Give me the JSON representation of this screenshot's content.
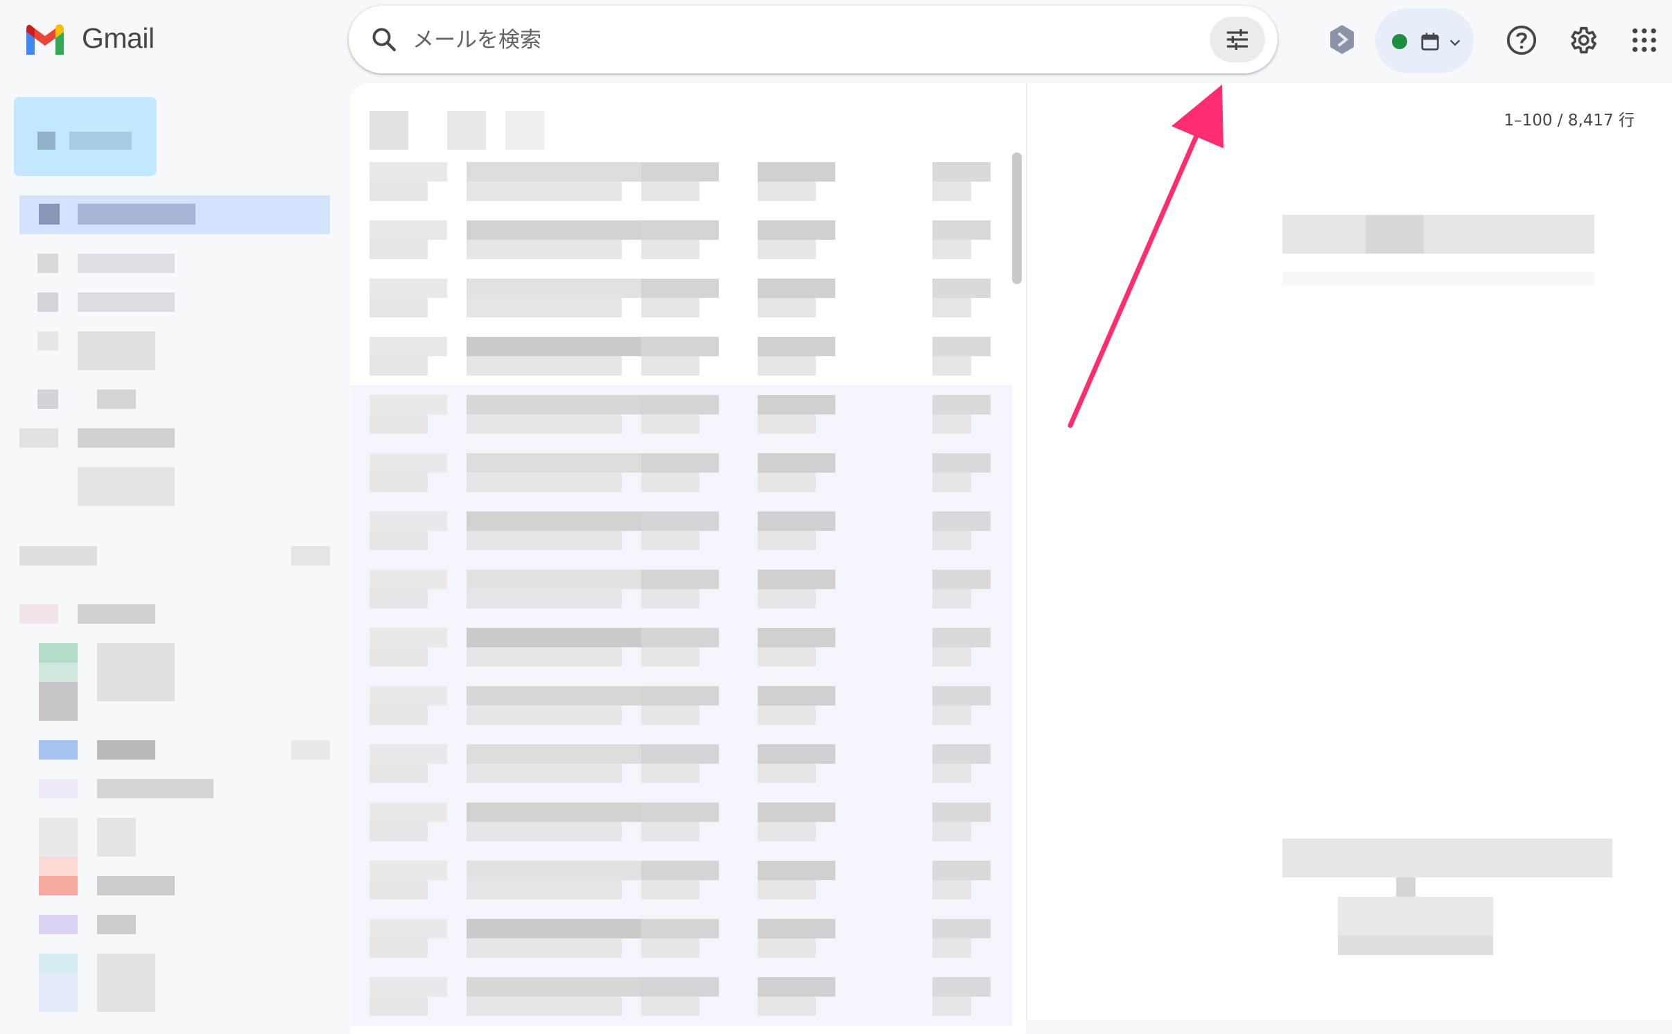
{
  "header": {
    "app_name": "Gmail",
    "logo_icon": "gmail-m-logo",
    "search": {
      "placeholder": "メールを検索",
      "value": "",
      "search_icon": "search-icon",
      "filter_icon": "search-options-sliders-icon"
    },
    "extension_icon": "extension-hexagon-icon",
    "status_chip": {
      "status_color": "#1e8e3e",
      "icon": "calendar-icon",
      "dropdown_icon": "chevron-down-icon"
    },
    "help_icon": "help-icon",
    "settings_icon": "gear-icon",
    "apps_icon": "apps-grid-icon"
  },
  "message_list": {
    "pagination_label": "1–100 / 8,417 行",
    "rows_blurred": true,
    "row_count_visible": 15
  },
  "annotation": {
    "arrow_color": "#ff2d6f",
    "target": "search-options-button"
  },
  "colors": {
    "background": "#f6f8fc",
    "panel": "#ffffff",
    "read_row": "#f2f6fc"
  }
}
